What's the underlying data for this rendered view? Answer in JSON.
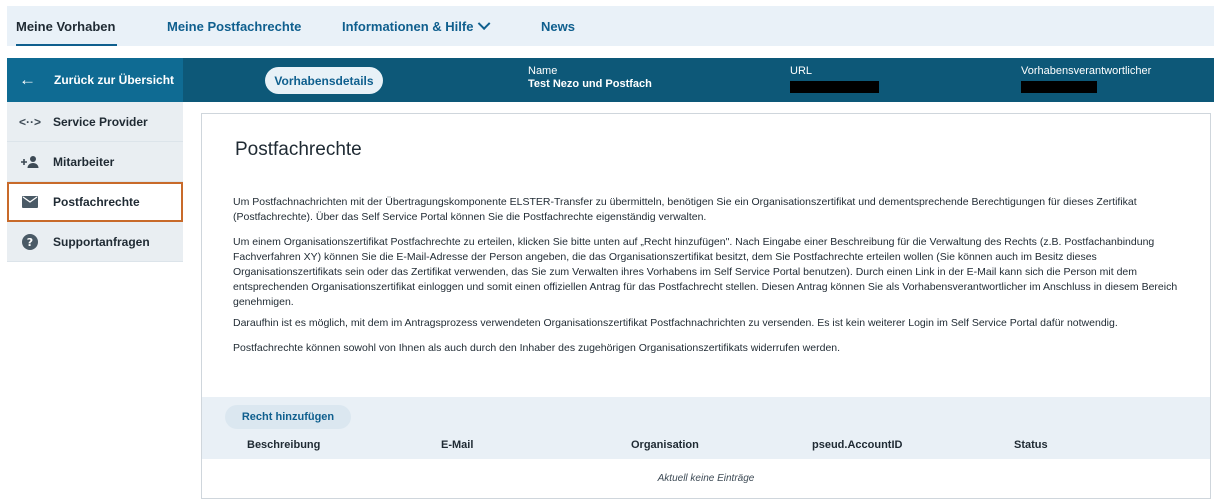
{
  "topnav": {
    "tabs": [
      {
        "label": "Meine Vorhaben",
        "active": true
      },
      {
        "label": "Meine Postfachrechte",
        "active": false
      },
      {
        "label": "Informationen & Hilfe",
        "active": false,
        "icon": "chevron-down-icon"
      },
      {
        "label": "News",
        "active": false
      }
    ]
  },
  "header": {
    "back_label": "Zurück zur Übersicht",
    "back_icon": "arrow-left-icon",
    "details_button": "Vorhabensdetails",
    "name_label": "Name",
    "name_value": "Test Nezo und Postfach",
    "url_label": "URL",
    "responsible_label": "Vorhabensverantwortlicher"
  },
  "sidebar": {
    "items": [
      {
        "label": "Service Provider",
        "icon": "code-brackets-icon",
        "active": false
      },
      {
        "label": "Mitarbeiter",
        "icon": "add-user-icon",
        "active": false
      },
      {
        "label": "Postfachrechte",
        "icon": "envelope-icon",
        "active": true
      },
      {
        "label": "Supportanfragen",
        "icon": "help-icon",
        "active": false
      }
    ]
  },
  "main": {
    "title": "Postfachrechte",
    "paragraphs": [
      "Um Postfachnachrichten mit der Übertragungskomponente ELSTER-Transfer zu übermitteln, benötigen Sie ein Organisationszertifikat und dementsprechende Berechtigungen für dieses Zertifikat (Postfachrechte). Über das Self Service Portal können Sie die Postfachrechte eigenständig verwalten.",
      "Um einem Organisationszertifikat Postfachrechte zu erteilen, klicken Sie bitte unten auf „Recht hinzufügen\". Nach Eingabe einer Beschreibung für die Verwaltung des Rechts (z.B. Postfachanbindung Fachverfahren XY) können Sie die E-Mail-Adresse der Person angeben, die das Organisationszertifikat besitzt, dem Sie Postfachrechte erteilen wollen (Sie können auch im Besitz dieses Organisationszertifikats sein oder das Zertifikat verwenden, das Sie zum Verwalten ihres Vorhabens im Self Service Portal benutzen). Durch einen Link in der E-Mail kann sich die Person mit dem entsprechenden Organisationszertifikat einloggen und somit einen offiziellen Antrag für das Postfachrecht stellen. Diesen Antrag können Sie als Vorhabensverantwortlicher im Anschluss in diesem Bereich genehmigen.",
      "Daraufhin ist es möglich, mit dem im Antragsprozess verwendeten Organisationszertifikat Postfachnachrichten zu versenden. Es ist kein weiterer Login im Self Service Portal dafür notwendig.",
      "Postfachrechte können sowohl von Ihnen als auch durch den Inhaber des zugehörigen Organisationszertifikats widerrufen werden."
    ],
    "add_button": "Recht hinzufügen",
    "table": {
      "columns": [
        "Beschreibung",
        "E-Mail",
        "Organisation",
        "pseud.AccountID",
        "Status"
      ],
      "empty_text": "Aktuell keine Einträge"
    }
  }
}
